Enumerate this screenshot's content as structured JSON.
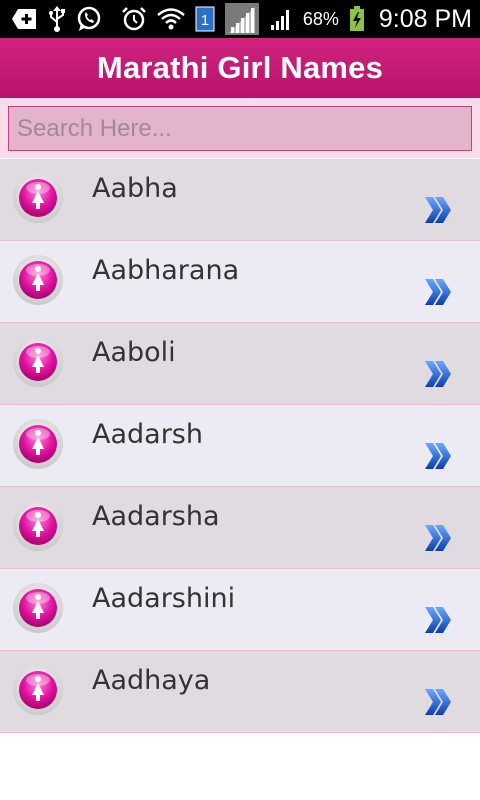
{
  "status_bar": {
    "battery_percent": "68%",
    "time": "9:08 PM",
    "sim_badge": "1",
    "icons": [
      "add-icon",
      "usb-icon",
      "whatsapp-icon",
      "alarm-icon",
      "wifi-icon",
      "sim-icon",
      "signal-icon",
      "signal-icon",
      "battery-charging-icon"
    ]
  },
  "header": {
    "title": "Marathi Girl Names"
  },
  "search": {
    "placeholder": "Search Here..."
  },
  "list": {
    "items": [
      {
        "label": "Aabha"
      },
      {
        "label": "Aabharana"
      },
      {
        "label": "Aaboli"
      },
      {
        "label": "Aadarsh"
      },
      {
        "label": "Aadarsha"
      },
      {
        "label": "Aadarshini"
      },
      {
        "label": "Aadhaya"
      }
    ],
    "item_icon": "female-icon",
    "item_action_icon": "double-chevron-right-icon"
  },
  "colors": {
    "accent": "#c2187a",
    "row_odd": "#e0dbe1",
    "row_even": "#ecebf3",
    "chevron_blue": "#1a5fd0"
  }
}
